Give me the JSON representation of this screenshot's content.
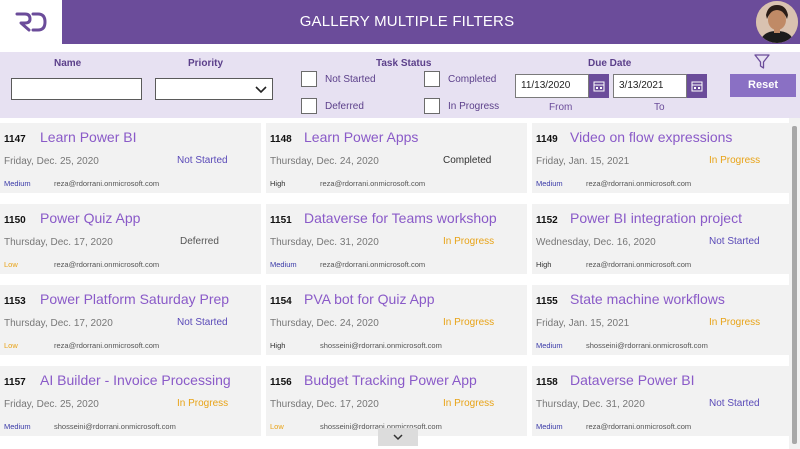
{
  "header": {
    "title": "GALLERY MULTIPLE FILTERS",
    "logo_text": "RD",
    "avatar_icon": "user-avatar"
  },
  "filters": {
    "name_label": "Name",
    "name_value": "",
    "priority_label": "Priority",
    "priority_value": "",
    "task_status_label": "Task Status",
    "status_options": [
      "Not Started",
      "Completed",
      "Deferred",
      "In Progress"
    ],
    "due_date_label": "Due Date",
    "from_date": "11/13/2020",
    "to_date": "3/13/2021",
    "from_label": "From",
    "to_label": "To",
    "reset_label": "Reset",
    "filter_icon": "funnel-icon",
    "calendar_icon": "calendar-icon"
  },
  "colors": {
    "brand": "#6b4c9a",
    "title_purple": "#8a5ac8",
    "not_started": "#5a4ab8",
    "completed": "#333333",
    "deferred": "#555555",
    "in_progress": "#e8a317",
    "medium": "#3a3aa8",
    "high": "#333333",
    "low": "#e8a317"
  },
  "tasks": [
    {
      "id": "1147",
      "title": "Learn Power BI",
      "date": "Friday, Dec. 25, 2020",
      "status": "Not Started",
      "priority": "Medium",
      "email": "reza@rdorrani.onmicrosoft.com"
    },
    {
      "id": "1148",
      "title": "Learn Power Apps",
      "date": "Thursday, Dec. 24, 2020",
      "status": "Completed",
      "priority": "High",
      "email": "reza@rdorrani.onmicrosoft.com"
    },
    {
      "id": "1149",
      "title": "Video on flow expressions",
      "date": "Friday, Jan. 15, 2021",
      "status": "In Progress",
      "priority": "Medium",
      "email": "reza@rdorrani.onmicrosoft.com"
    },
    {
      "id": "1150",
      "title": "Power Quiz App",
      "date": "Thursday, Dec. 17, 2020",
      "status": "Deferred",
      "priority": "Low",
      "email": "reza@rdorrani.onmicrosoft.com"
    },
    {
      "id": "1151",
      "title": "Dataverse for Teams workshop",
      "date": "Thursday, Dec. 31, 2020",
      "status": "In Progress",
      "priority": "Medium",
      "email": "reza@rdorrani.onmicrosoft.com"
    },
    {
      "id": "1152",
      "title": "Power BI integration project",
      "date": "Wednesday, Dec. 16, 2020",
      "status": "Not Started",
      "priority": "High",
      "email": "reza@rdorrani.onmicrosoft.com"
    },
    {
      "id": "1153",
      "title": "Power Platform Saturday Prep",
      "date": "Thursday, Dec. 17, 2020",
      "status": "Not Started",
      "priority": "Low",
      "email": "reza@rdorrani.onmicrosoft.com"
    },
    {
      "id": "1154",
      "title": "PVA bot for Quiz App",
      "date": "Thursday, Dec. 24, 2020",
      "status": "In Progress",
      "priority": "High",
      "email": "shosseini@rdorrani.onmicrosoft.com"
    },
    {
      "id": "1155",
      "title": "State machine workflows",
      "date": "Friday, Jan. 15, 2021",
      "status": "In Progress",
      "priority": "Medium",
      "email": "shosseini@rdorrani.onmicrosoft.com"
    },
    {
      "id": "1157",
      "title": "AI Builder - Invoice Processing",
      "date": "Friday, Dec. 25, 2020",
      "status": "In Progress",
      "priority": "Medium",
      "email": "shosseini@rdorrani.onmicrosoft.com"
    },
    {
      "id": "1156",
      "title": "Budget Tracking Power App",
      "date": "Thursday, Dec. 17, 2020",
      "status": "In Progress",
      "priority": "Low",
      "email": "shosseini@rdorrani.onmicrosoft.com"
    },
    {
      "id": "1158",
      "title": "Dataverse Power BI",
      "date": "Thursday, Dec. 31, 2020",
      "status": "Not Started",
      "priority": "Medium",
      "email": "reza@rdorrani.onmicrosoft.com"
    }
  ]
}
